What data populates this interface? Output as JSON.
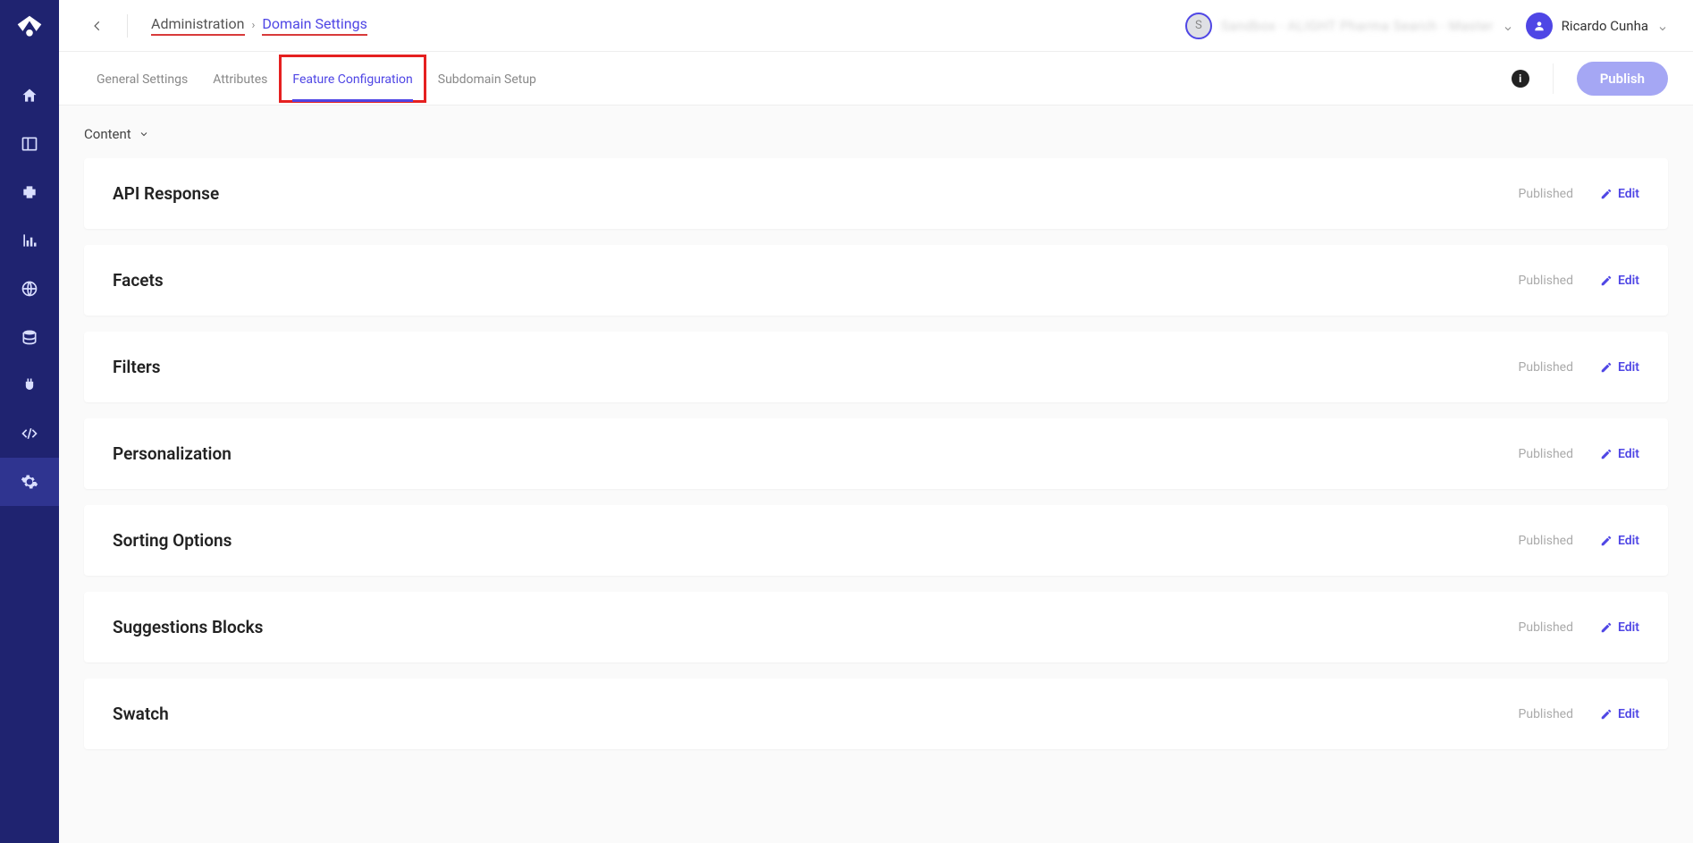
{
  "breadcrumb": {
    "root": "Administration",
    "leaf": "Domain Settings"
  },
  "topbar": {
    "account_badge_initial": "S",
    "account_name": "Sandbox - ALIGHT Pharma Search - Master",
    "user_name": "Ricardo Cunha"
  },
  "tabs": [
    {
      "label": "General Settings",
      "active": false
    },
    {
      "label": "Attributes",
      "active": false
    },
    {
      "label": "Feature Configuration",
      "active": true,
      "highlighted": true
    },
    {
      "label": "Subdomain Setup",
      "active": false
    }
  ],
  "publish_label": "Publish",
  "content_dropdown_label": "Content",
  "cards": [
    {
      "title": "API Response",
      "status": "Published",
      "action": "Edit"
    },
    {
      "title": "Facets",
      "status": "Published",
      "action": "Edit"
    },
    {
      "title": "Filters",
      "status": "Published",
      "action": "Edit"
    },
    {
      "title": "Personalization",
      "status": "Published",
      "action": "Edit"
    },
    {
      "title": "Sorting Options",
      "status": "Published",
      "action": "Edit"
    },
    {
      "title": "Suggestions Blocks",
      "status": "Published",
      "action": "Edit"
    },
    {
      "title": "Swatch",
      "status": "Published",
      "action": "Edit"
    }
  ],
  "sidebar_icons": [
    "home-icon",
    "panel-icon",
    "puzzle-icon",
    "chart-icon",
    "globe-icon",
    "database-icon",
    "plug-icon",
    "code-icon",
    "gear-icon"
  ]
}
